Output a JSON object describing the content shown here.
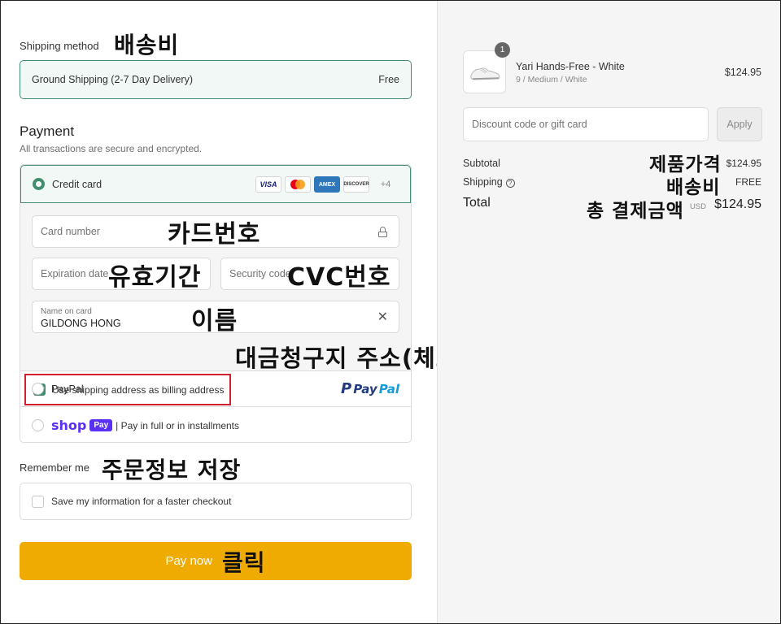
{
  "shipping": {
    "label": "Shipping method",
    "annotation": "배송비",
    "option": "Ground Shipping (2-7 Day Delivery)",
    "price": "Free"
  },
  "payment": {
    "title": "Payment",
    "subtitle": "All transactions are secure and encrypted.",
    "credit_card_label": "Credit card",
    "card_brands": [
      "VISA",
      "AMEX",
      "DISCOVER",
      "+4"
    ],
    "card_number_placeholder": "Card number",
    "card_number_annotation": "카드번호",
    "expiration_placeholder": "Expiration date",
    "expiration_annotation": "유효기간",
    "security_placeholder": "Security code",
    "security_annotation": "CVC번호",
    "name_label": "Name on card",
    "name_value": "GILDONG HONG",
    "name_annotation": "이름",
    "billing_label": "Use shipping address as billing address",
    "billing_annotation": "대금청구지 주소(체크o)",
    "paypal_label": "PayPal",
    "paypal_logo_pay": "Pay",
    "paypal_logo_pal": "Pal",
    "shop_word": "shop",
    "shop_badge": "Pay",
    "shop_text": "| Pay in full or in installments"
  },
  "remember": {
    "label": "Remember me",
    "annotation": "주문정보 저장",
    "checkbox_label": "Save my information for a faster checkout"
  },
  "pay_button": {
    "label": "Pay now",
    "annotation": "클릭"
  },
  "order": {
    "quantity_badge": "1",
    "product_name": "Yari Hands-Free - White",
    "product_variant": "9 / Medium / White",
    "product_price": "$124.95",
    "discount_placeholder": "Discount code or gift card",
    "apply_label": "Apply",
    "subtotal_label": "Subtotal",
    "subtotal_value": "$124.95",
    "subtotal_annotation": "제품가격",
    "shipping_label": "Shipping",
    "shipping_value": "FREE",
    "shipping_annotation": "배송비",
    "total_label": "Total",
    "total_currency": "USD",
    "total_value": "$124.95",
    "total_annotation": "총 결제금액"
  },
  "colors": {
    "accent_green": "#3f8f6f",
    "pay_button": "#efab02",
    "highlight_red": "#d01f2f",
    "shop_purple": "#5a31f4"
  }
}
